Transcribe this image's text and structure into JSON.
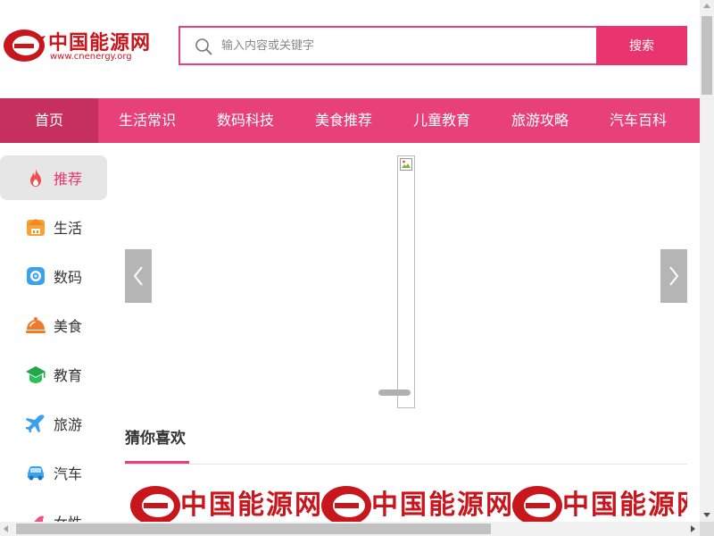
{
  "header": {
    "logo_text": "中国能源网",
    "logo_url": "www.cnenergy.org"
  },
  "search": {
    "placeholder": "输入内容或关键字",
    "button_label": "搜索"
  },
  "nav": {
    "items": [
      "首页",
      "生活常识",
      "数码科技",
      "美食推荐",
      "儿童教育",
      "旅游攻略",
      "汽车百科"
    ],
    "active_index": 0
  },
  "sidebar": {
    "items": [
      {
        "label": "推荐",
        "icon": "fire-icon"
      },
      {
        "label": "生活",
        "icon": "house-icon"
      },
      {
        "label": "数码",
        "icon": "camera-icon"
      },
      {
        "label": "美食",
        "icon": "food-cloche-icon"
      },
      {
        "label": "教育",
        "icon": "graduation-cap-icon"
      },
      {
        "label": "旅游",
        "icon": "airplane-icon"
      },
      {
        "label": "汽车",
        "icon": "car-icon"
      },
      {
        "label": "女性",
        "icon": "heels-icon"
      }
    ],
    "active_index": 0
  },
  "section": {
    "title": "猜你喜欢"
  },
  "cards": [
    {
      "logo_text": "中国能源网"
    },
    {
      "logo_text": "中国能源网"
    },
    {
      "logo_text": "中国能源网"
    }
  ],
  "colors": {
    "brand_pink": "#e8417a",
    "nav_active": "#c6305f",
    "logo_red": "#c8161d",
    "sidebar_active_bg": "#e6e6e6"
  }
}
